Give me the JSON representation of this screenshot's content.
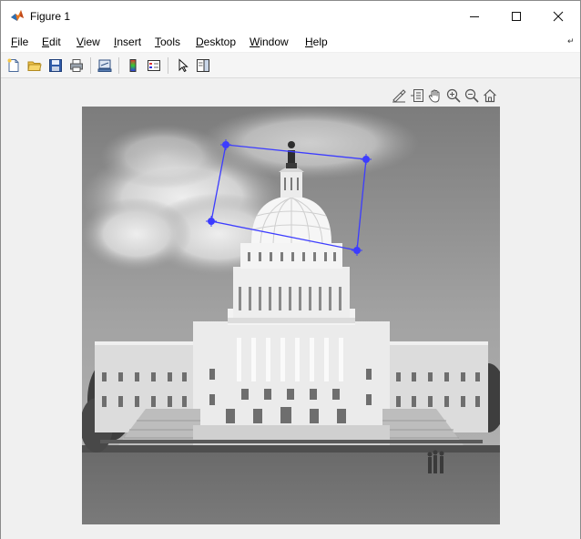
{
  "window": {
    "title": "Figure 1"
  },
  "menu": {
    "items": [
      {
        "label": "File",
        "accel": "F",
        "rest": "ile"
      },
      {
        "label": "Edit",
        "accel": "E",
        "rest": "dit"
      },
      {
        "label": "View",
        "accel": "V",
        "rest": "iew"
      },
      {
        "label": "Insert",
        "accel": "I",
        "rest": "nsert"
      },
      {
        "label": "Tools",
        "accel": "T",
        "rest": "ools"
      },
      {
        "label": "Desktop",
        "accel": "D",
        "rest": "esktop"
      },
      {
        "label": "Window",
        "accel": "W",
        "rest": "indow"
      },
      {
        "label": "Help",
        "accel": "H",
        "rest": "elp"
      }
    ]
  },
  "toolbar": {
    "buttons": [
      "new-figure-icon",
      "open-file-icon",
      "save-icon",
      "print-icon",
      "link-plot-icon",
      "insert-colorbar-icon",
      "insert-legend-icon",
      "edit-plot-arrow-icon",
      "open-property-inspector-icon"
    ]
  },
  "axes_toolbar": {
    "buttons": [
      "brush-icon",
      "data-tips-icon",
      "pan-hand-icon",
      "zoom-in-icon",
      "zoom-out-icon",
      "restore-view-home-icon"
    ]
  },
  "image": {
    "subject": "Grayscale photo of the U.S. Capitol building with lawn and sky",
    "roi_color": "#3c3cff"
  },
  "colors": {
    "titlebar": "#ffffff",
    "menubar": "#ffffff",
    "figure_bg": "#f0f0f0",
    "roi": "#3c3cff"
  }
}
